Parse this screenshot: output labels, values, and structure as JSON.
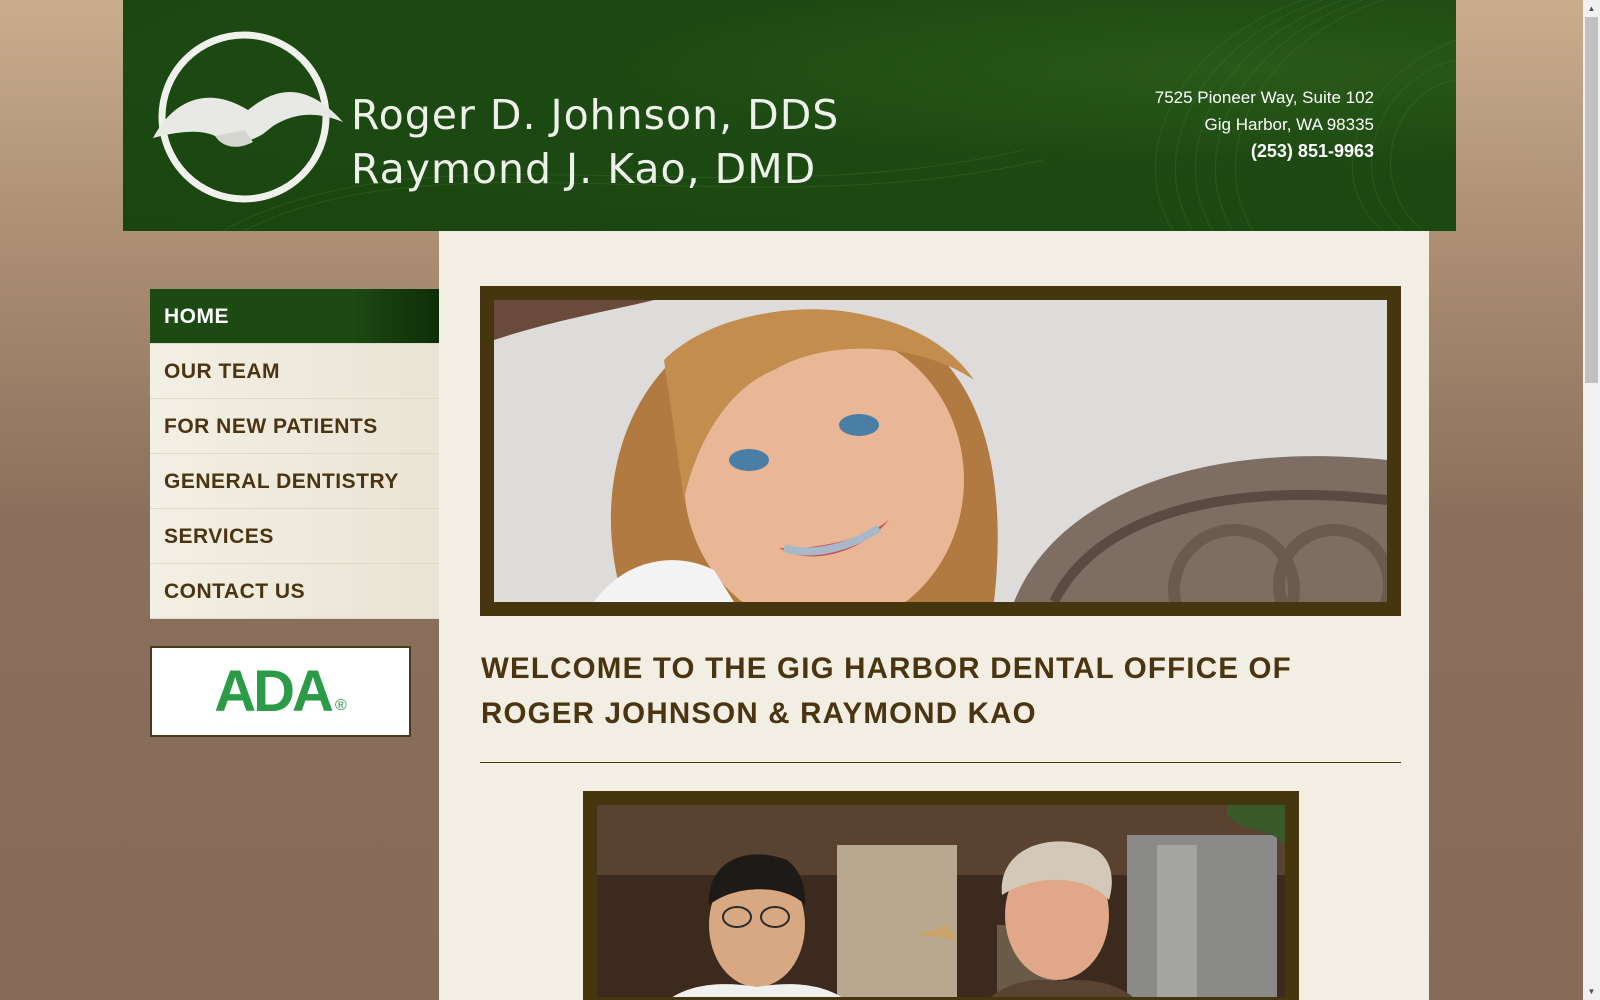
{
  "header": {
    "doctor_1": "Roger D. Johnson, DDS",
    "doctor_2": "Raymond J. Kao, DMD",
    "address_line_1": "7525 Pioneer Way, Suite 102",
    "address_line_2": "Gig Harbor, WA 98335",
    "phone": "(253) 851-9963"
  },
  "nav": {
    "items": [
      {
        "label": "HOME",
        "active": true
      },
      {
        "label": "OUR TEAM"
      },
      {
        "label": "FOR NEW PATIENTS"
      },
      {
        "label": "GENERAL DENTISTRY"
      },
      {
        "label": "SERVICES"
      },
      {
        "label": "CONTACT US"
      }
    ]
  },
  "badge": {
    "text": "ADA",
    "mark": "®"
  },
  "main": {
    "welcome_heading_line_1": "WELCOME TO THE GIG HARBOR DENTAL OFFICE OF",
    "welcome_heading_line_2": "ROGER JOHNSON & RAYMOND KAO"
  },
  "colors": {
    "header_green": "#1d4a12",
    "nav_text": "#4a3510",
    "frame_brown": "#45360f",
    "content_bg": "#f2eee3",
    "ada_green": "#2c9b47"
  }
}
